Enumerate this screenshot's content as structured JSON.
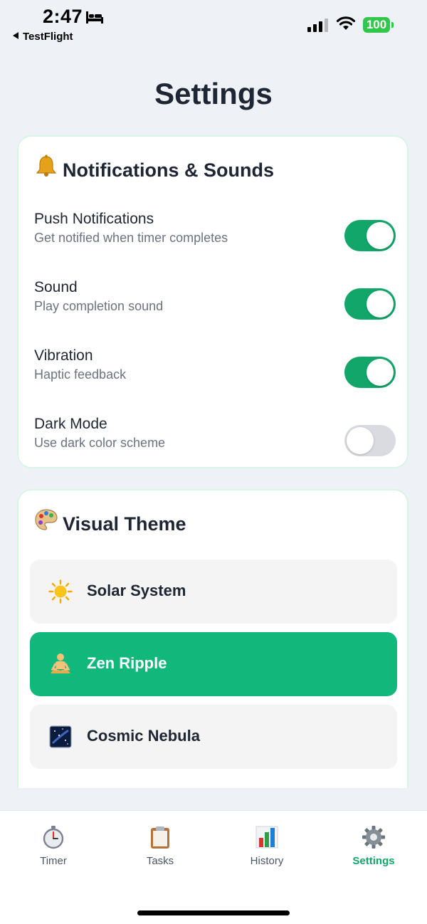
{
  "status_bar": {
    "time": "2:47",
    "back_app": "TestFlight",
    "battery": "100"
  },
  "page": {
    "title": "Settings"
  },
  "notifications": {
    "title": "Notifications & Sounds",
    "icon": "bell-icon",
    "settings": [
      {
        "label": "Push Notifications",
        "description": "Get notified when timer completes",
        "enabled": true
      },
      {
        "label": "Sound",
        "description": "Play completion sound",
        "enabled": true
      },
      {
        "label": "Vibration",
        "description": "Haptic feedback",
        "enabled": true
      },
      {
        "label": "Dark Mode",
        "description": "Use dark color scheme",
        "enabled": false
      }
    ]
  },
  "theme": {
    "title": "Visual Theme",
    "icon": "palette-icon",
    "options": [
      {
        "label": "Solar System",
        "icon": "sun-icon",
        "selected": false
      },
      {
        "label": "Zen Ripple",
        "icon": "meditation-icon",
        "selected": true
      },
      {
        "label": "Cosmic Nebula",
        "icon": "galaxy-icon",
        "selected": false
      }
    ]
  },
  "tab_bar": {
    "tabs": [
      {
        "label": "Timer",
        "icon": "stopwatch-icon",
        "active": false
      },
      {
        "label": "Tasks",
        "icon": "clipboard-icon",
        "active": false
      },
      {
        "label": "History",
        "icon": "bar-chart-icon",
        "active": false
      },
      {
        "label": "Settings",
        "icon": "gear-icon",
        "active": true
      }
    ]
  },
  "colors": {
    "accent": "#12a66a",
    "selected_theme": "#12b77c",
    "background": "#eef2f7",
    "card_border": "#d8f4e4"
  }
}
